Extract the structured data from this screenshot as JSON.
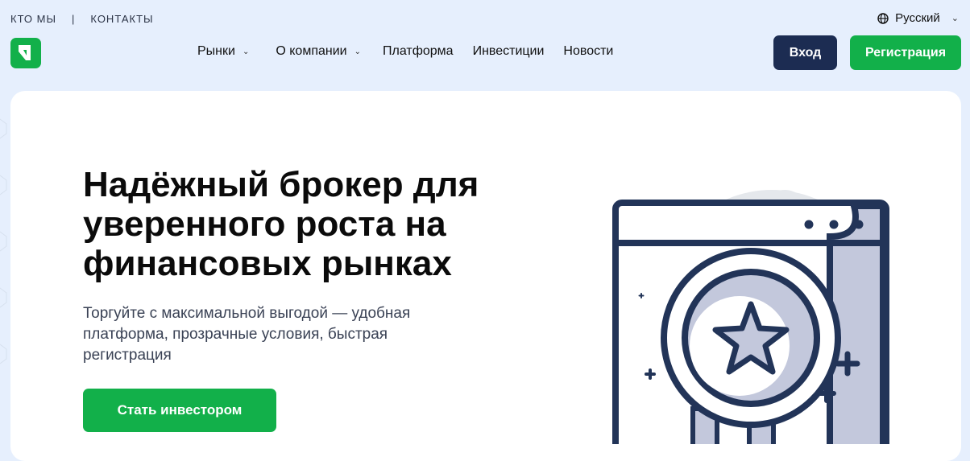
{
  "topbar": {
    "links": [
      "КТО МЫ",
      "КОНТАКТЫ"
    ],
    "separator": "|",
    "language": "Русский"
  },
  "nav": {
    "items": [
      {
        "label": "Рынки",
        "has_dropdown": true
      },
      {
        "label": "О компании",
        "has_dropdown": true
      },
      {
        "label": "Платформа",
        "has_dropdown": false
      },
      {
        "label": "Инвестиции",
        "has_dropdown": false
      },
      {
        "label": "Новости",
        "has_dropdown": false
      }
    ]
  },
  "auth": {
    "login_label": "Вход",
    "register_label": "Регистрация"
  },
  "hero": {
    "title": "Надёжный брокер для уверенного роста на финансовых рынках",
    "subtitle": "Торгуйте с максимальной выгодой — удобная платформа, прозрачные условия, быстрая регистрация",
    "cta_label": "Стать инвестором"
  },
  "icons": {
    "logo": "brand-logo-icon",
    "language": "globe-icon",
    "dropdown": "chevron-down-icon",
    "illustration": "award-star-medal-icon"
  },
  "colors": {
    "background": "#e6effd",
    "accent_green": "#12b04a",
    "navy": "#1c2c52",
    "illustration_stroke": "#223458",
    "illustration_fill": "#c3c8dc"
  }
}
